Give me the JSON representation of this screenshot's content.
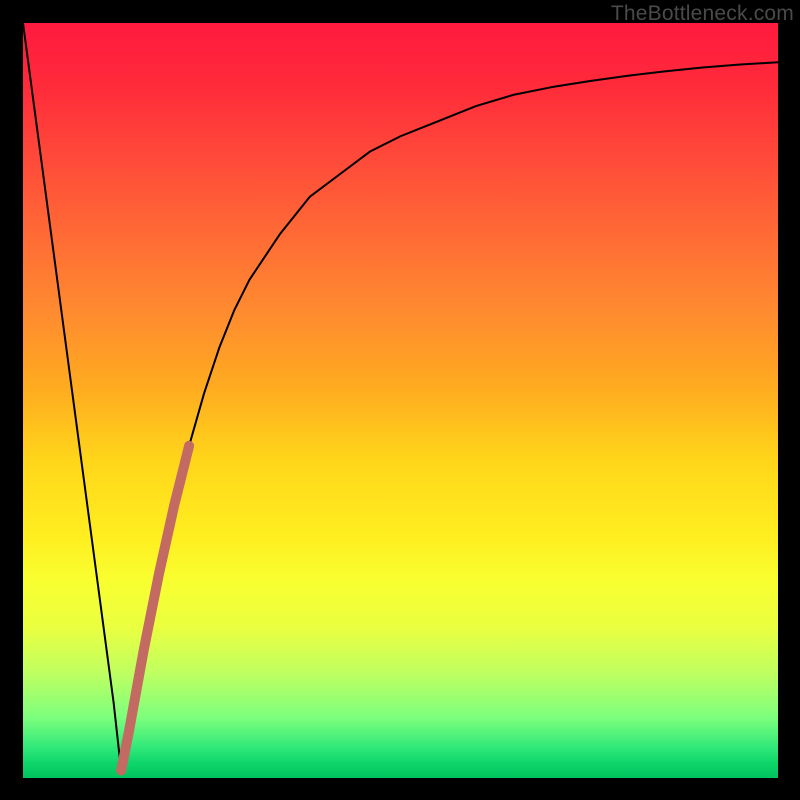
{
  "watermark": "TheBottleneck.com",
  "chart_data": {
    "type": "line",
    "title": "",
    "xlabel": "",
    "ylabel": "",
    "xlim": [
      0,
      100
    ],
    "ylim": [
      0,
      100
    ],
    "grid": false,
    "legend": false,
    "series": [
      {
        "name": "bottleneck-curve",
        "color": "#000000",
        "width": 2,
        "x": [
          0,
          2,
          4,
          6,
          8,
          10,
          12,
          13,
          14,
          16,
          18,
          20,
          22,
          24,
          26,
          28,
          30,
          34,
          38,
          42,
          46,
          50,
          55,
          60,
          65,
          70,
          75,
          80,
          85,
          90,
          95,
          100
        ],
        "values": [
          100,
          85,
          70,
          55,
          40,
          25,
          10,
          1,
          6,
          17,
          27,
          36,
          44,
          51,
          57,
          62,
          66,
          72,
          77,
          80,
          83,
          85,
          87,
          89,
          90.5,
          91.5,
          92.3,
          93,
          93.6,
          94.1,
          94.5,
          94.8
        ]
      },
      {
        "name": "highlight-segment",
        "color": "#c36a62",
        "width": 10,
        "x": [
          13,
          14,
          16,
          18,
          20,
          22
        ],
        "values": [
          1,
          6,
          17,
          27,
          36,
          44
        ]
      }
    ]
  }
}
